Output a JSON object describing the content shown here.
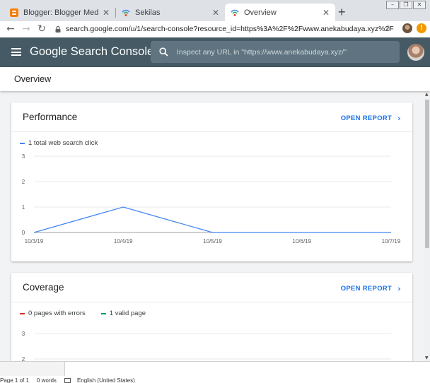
{
  "browser": {
    "tabs": [
      {
        "title": "Blogger: Blogger Media - Semua",
        "favicon": "blogger-icon"
      },
      {
        "title": "Sekilas",
        "favicon": "search-console-icon"
      },
      {
        "title": "Overview",
        "favicon": "search-console-icon",
        "active": true
      }
    ],
    "url": "search.google.com/u/1/search-console?resource_id=https%3A%2F%2Fwww.anekabudaya.xyz%2F"
  },
  "header": {
    "brand": "Google Search Console",
    "search_placeholder": "Inspect any URL in \"https://www.anekabudaya.xyz/\""
  },
  "page": {
    "title": "Overview"
  },
  "performance": {
    "title": "Performance",
    "open_report": "OPEN REPORT",
    "legend": [
      {
        "label": "1 total web search click",
        "color": "#4285f4"
      }
    ]
  },
  "coverage": {
    "title": "Coverage",
    "open_report": "OPEN REPORT",
    "legend": [
      {
        "label": "0 pages with errors",
        "color": "#d93025"
      },
      {
        "label": "1 valid page",
        "color": "#0f9d58"
      }
    ]
  },
  "statusbar": {
    "page": "Page 1 of 1",
    "words": "0 words",
    "language": "English (United States)"
  },
  "chart_data": [
    {
      "type": "line",
      "x": [
        "10/3/19",
        "10/4/19",
        "10/5/19",
        "10/6/19",
        "10/7/19"
      ],
      "series": [
        {
          "name": "1 total web search click",
          "values": [
            0,
            1,
            0,
            0,
            0
          ],
          "color": "#4285f4"
        }
      ],
      "yticks": [
        0,
        1,
        2,
        3
      ],
      "ylim": [
        0,
        3
      ],
      "grid": true
    },
    {
      "type": "line",
      "yticks": [
        2,
        3
      ],
      "ylim": [
        0,
        3
      ],
      "grid": true
    }
  ]
}
